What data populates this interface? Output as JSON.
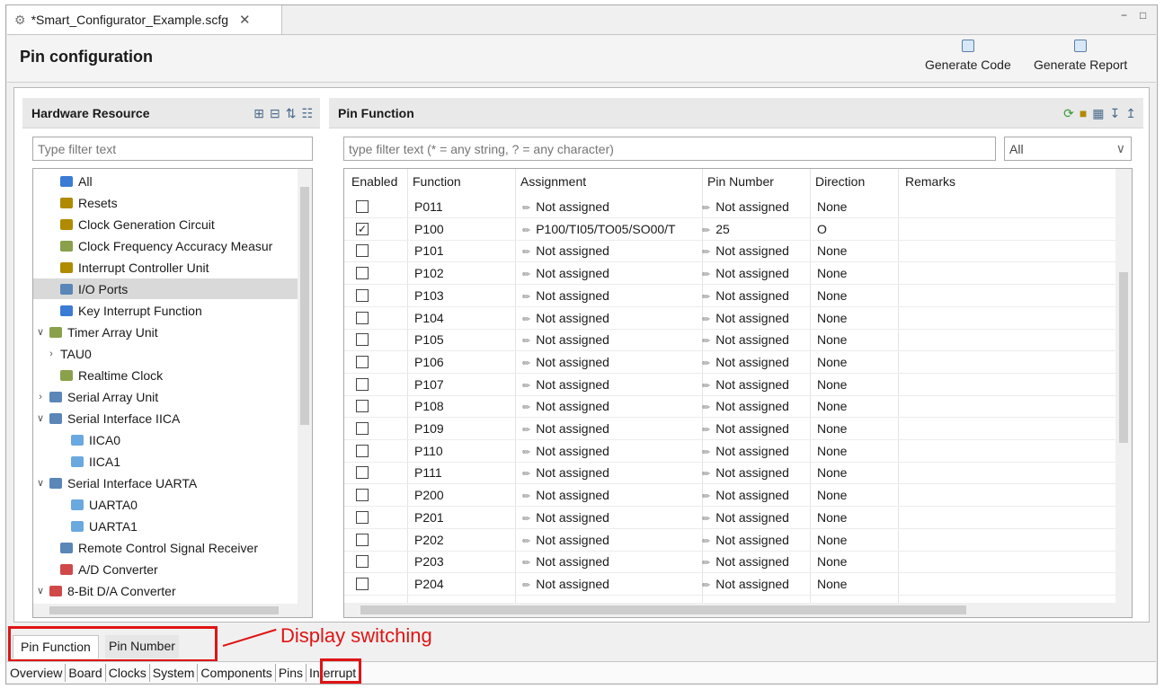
{
  "window": {
    "tab_title": "*Smart_Configurator_Example.scfg",
    "tab_close": "✕",
    "minimize": "−",
    "maximize": "□"
  },
  "header": {
    "title": "Pin configuration",
    "generate_code": "Generate Code",
    "generate_report": "Generate Report"
  },
  "hardware": {
    "title": "Hardware Resource",
    "filter_placeholder": "Type filter text",
    "items": [
      {
        "label": "All",
        "icon": "all-resources-icon",
        "color": "#3a7bd5",
        "level": 1,
        "twisty": ""
      },
      {
        "label": "Resets",
        "icon": "chip-icon",
        "color": "#b08a00",
        "level": 1,
        "twisty": ""
      },
      {
        "label": "Clock Generation Circuit",
        "icon": "chip-icon",
        "color": "#b08a00",
        "level": 1,
        "twisty": ""
      },
      {
        "label": "Clock Frequency Accuracy Measur",
        "icon": "clock-icon",
        "color": "#8aa04a",
        "level": 1,
        "twisty": ""
      },
      {
        "label": "Interrupt Controller Unit",
        "icon": "chip-icon",
        "color": "#b08a00",
        "level": 1,
        "twisty": ""
      },
      {
        "label": "I/O Ports",
        "icon": "io-port-icon",
        "color": "#5a86b8",
        "level": 1,
        "twisty": "",
        "selected": true
      },
      {
        "label": "Key Interrupt Function",
        "icon": "key-interrupt-icon",
        "color": "#3a7bd5",
        "level": 1,
        "twisty": ""
      },
      {
        "label": "Timer Array Unit",
        "icon": "timer-icon",
        "color": "#8aa04a",
        "level": 0,
        "twisty": "∨"
      },
      {
        "label": "TAU0",
        "icon": "",
        "color": "",
        "level": 1,
        "twisty": "›"
      },
      {
        "label": "Realtime Clock",
        "icon": "timer-icon",
        "color": "#8aa04a",
        "level": 1,
        "twisty": ""
      },
      {
        "label": "Serial Array Unit",
        "icon": "serial-icon",
        "color": "#5a86b8",
        "level": 0,
        "twisty": "›"
      },
      {
        "label": "Serial Interface IICA",
        "icon": "serial-icon",
        "color": "#5a86b8",
        "level": 0,
        "twisty": "∨"
      },
      {
        "label": "IICA0",
        "icon": "channel-icon",
        "color": "#6aa8e0",
        "level": 2,
        "twisty": ""
      },
      {
        "label": "IICA1",
        "icon": "channel-icon",
        "color": "#6aa8e0",
        "level": 2,
        "twisty": ""
      },
      {
        "label": "Serial Interface UARTA",
        "icon": "serial-icon",
        "color": "#5a86b8",
        "level": 0,
        "twisty": "∨"
      },
      {
        "label": "UARTA0",
        "icon": "channel-icon",
        "color": "#6aa8e0",
        "level": 2,
        "twisty": ""
      },
      {
        "label": "UARTA1",
        "icon": "channel-icon",
        "color": "#6aa8e0",
        "level": 2,
        "twisty": ""
      },
      {
        "label": "Remote Control Signal Receiver",
        "icon": "serial-icon",
        "color": "#5a86b8",
        "level": 1,
        "twisty": ""
      },
      {
        "label": "A/D Converter",
        "icon": "ad-converter-icon",
        "color": "#d04848",
        "level": 1,
        "twisty": ""
      },
      {
        "label": "8-Bit D/A Converter",
        "icon": "da-converter-icon",
        "color": "#d04848",
        "level": 0,
        "twisty": "∨"
      }
    ]
  },
  "pin_function": {
    "title": "Pin Function",
    "filter_placeholder": "type filter text (* = any string, ? = any character)",
    "dropdown_value": "All",
    "columns": [
      "Enabled",
      "Function",
      "Assignment",
      "Pin Number",
      "Direction",
      "Remarks"
    ],
    "rows": [
      {
        "enabled": false,
        "function": "P011",
        "assignment": "Not assigned",
        "pin": "Not assigned",
        "direction": "None"
      },
      {
        "enabled": true,
        "function": "P100",
        "assignment": "P100/TI05/TO05/SO00/T",
        "pin": "25",
        "direction": "O"
      },
      {
        "enabled": false,
        "function": "P101",
        "assignment": "Not assigned",
        "pin": "Not assigned",
        "direction": "None"
      },
      {
        "enabled": false,
        "function": "P102",
        "assignment": "Not assigned",
        "pin": "Not assigned",
        "direction": "None"
      },
      {
        "enabled": false,
        "function": "P103",
        "assignment": "Not assigned",
        "pin": "Not assigned",
        "direction": "None"
      },
      {
        "enabled": false,
        "function": "P104",
        "assignment": "Not assigned",
        "pin": "Not assigned",
        "direction": "None"
      },
      {
        "enabled": false,
        "function": "P105",
        "assignment": "Not assigned",
        "pin": "Not assigned",
        "direction": "None"
      },
      {
        "enabled": false,
        "function": "P106",
        "assignment": "Not assigned",
        "pin": "Not assigned",
        "direction": "None"
      },
      {
        "enabled": false,
        "function": "P107",
        "assignment": "Not assigned",
        "pin": "Not assigned",
        "direction": "None"
      },
      {
        "enabled": false,
        "function": "P108",
        "assignment": "Not assigned",
        "pin": "Not assigned",
        "direction": "None"
      },
      {
        "enabled": false,
        "function": "P109",
        "assignment": "Not assigned",
        "pin": "Not assigned",
        "direction": "None"
      },
      {
        "enabled": false,
        "function": "P110",
        "assignment": "Not assigned",
        "pin": "Not assigned",
        "direction": "None"
      },
      {
        "enabled": false,
        "function": "P111",
        "assignment": "Not assigned",
        "pin": "Not assigned",
        "direction": "None"
      },
      {
        "enabled": false,
        "function": "P200",
        "assignment": "Not assigned",
        "pin": "Not assigned",
        "direction": "None"
      },
      {
        "enabled": false,
        "function": "P201",
        "assignment": "Not assigned",
        "pin": "Not assigned",
        "direction": "None"
      },
      {
        "enabled": false,
        "function": "P202",
        "assignment": "Not assigned",
        "pin": "Not assigned",
        "direction": "None"
      },
      {
        "enabled": false,
        "function": "P203",
        "assignment": "Not assigned",
        "pin": "Not assigned",
        "direction": "None"
      },
      {
        "enabled": false,
        "function": "P204",
        "assignment": "Not assigned",
        "pin": "Not assigned",
        "direction": "None"
      }
    ]
  },
  "view_tabs": {
    "pin_function": "Pin Function",
    "pin_number": "Pin Number"
  },
  "annotation": {
    "text": "Display switching",
    "color": "#e01414"
  },
  "nav_tabs": [
    "Overview",
    "Board",
    "Clocks",
    "System",
    "Components",
    "Pins",
    "Interrupt"
  ]
}
